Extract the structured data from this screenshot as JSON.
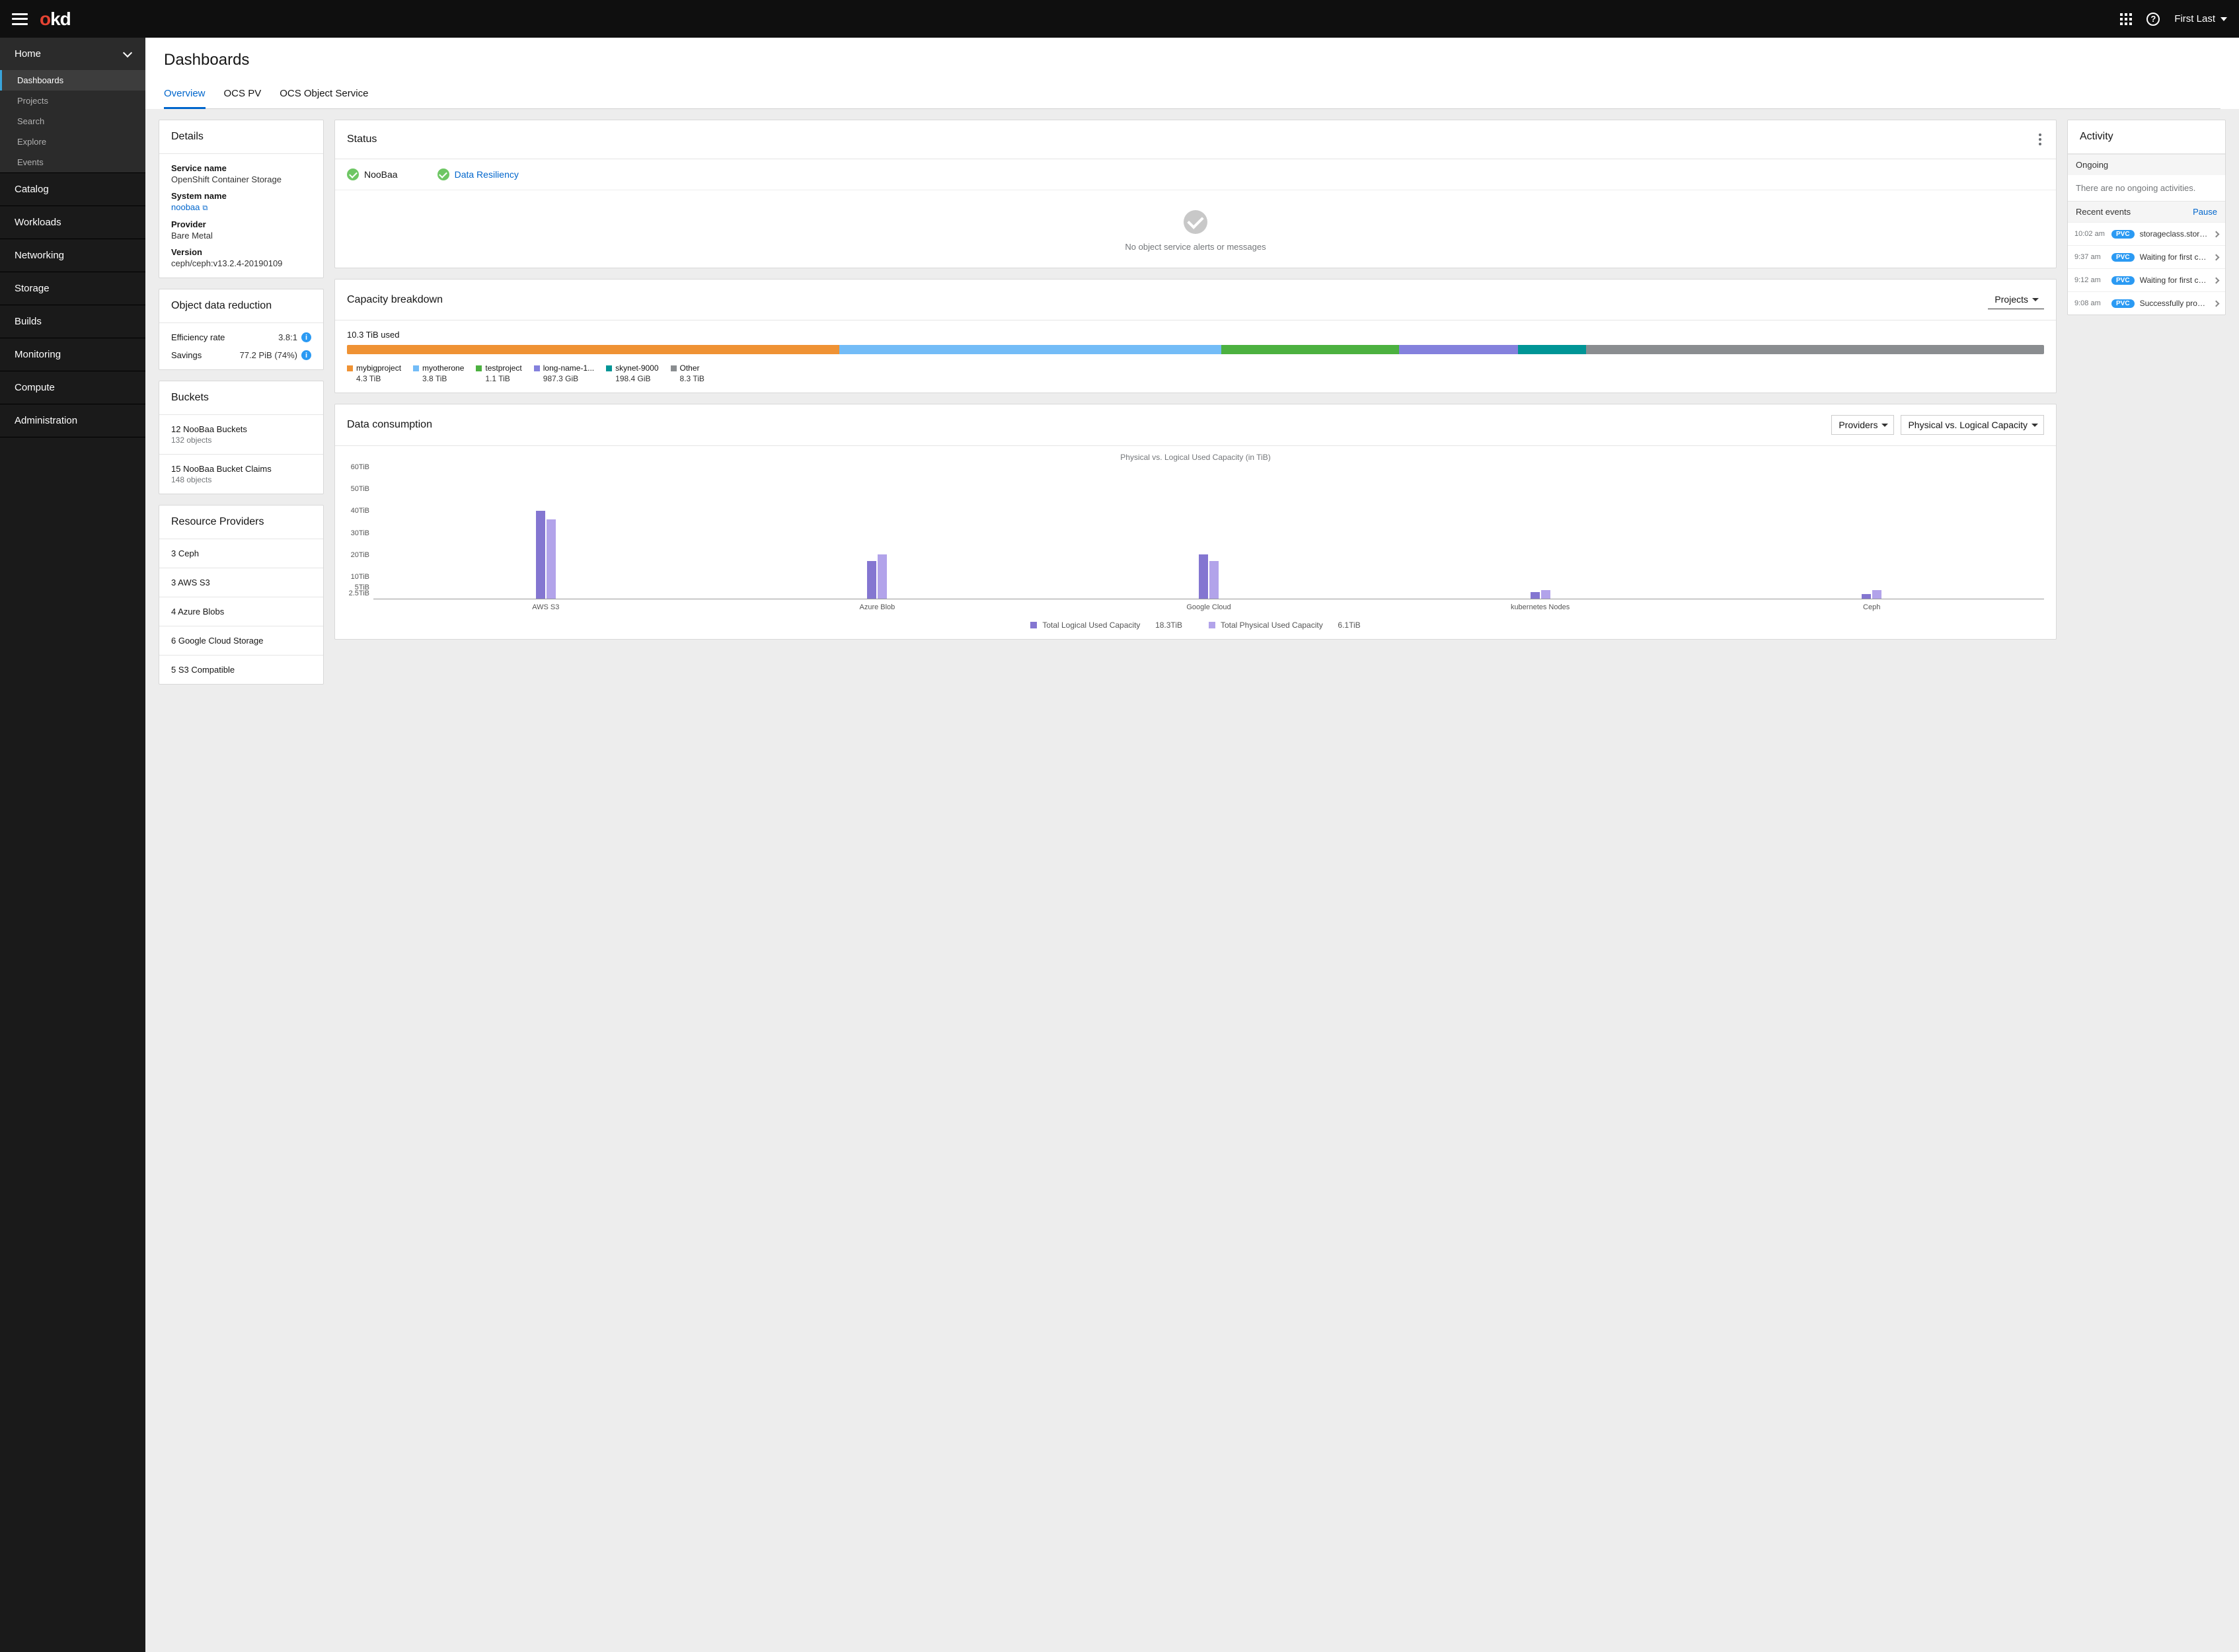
{
  "topbar": {
    "user": "First Last"
  },
  "sidebar": {
    "home": {
      "label": "Home",
      "items": [
        "Dashboards",
        "Projects",
        "Search",
        "Explore",
        "Events"
      ],
      "active": 0
    },
    "items": [
      "Catalog",
      "Workloads",
      "Networking",
      "Storage",
      "Builds",
      "Monitoring",
      "Compute",
      "Administration"
    ]
  },
  "page": {
    "title": "Dashboards"
  },
  "tabs": {
    "active": 0,
    "items": [
      "Overview",
      "OCS PV",
      "OCS Object Service"
    ]
  },
  "details": {
    "heading": "Details",
    "service_name_lbl": "Service name",
    "service_name": "OpenShift Container Storage",
    "system_name_lbl": "System name",
    "system_name": "noobaa",
    "provider_lbl": "Provider",
    "provider": "Bare Metal",
    "version_lbl": "Version",
    "version": "ceph/ceph:v13.2.4-20190109"
  },
  "reduction": {
    "heading": "Object data reduction",
    "eff_lbl": "Efficiency rate",
    "eff_val": "3.8:1",
    "sav_lbl": "Savings",
    "sav_val": "77.2 PiB (74%)"
  },
  "buckets": {
    "heading": "Buckets",
    "rows": [
      {
        "title": "12 NooBaa Buckets",
        "sub": "132 objects"
      },
      {
        "title": "15 NooBaa Bucket Claims",
        "sub": "148 objects"
      }
    ]
  },
  "providers": {
    "heading": "Resource Providers",
    "rows": [
      "3 Ceph",
      "3 AWS S3",
      "4 Azure Blobs",
      "6 Google Cloud Storage",
      "5 S3 Compatible"
    ]
  },
  "status": {
    "heading": "Status",
    "items": [
      {
        "label": "NooBaa",
        "link": false
      },
      {
        "label": "Data Resiliency",
        "link": true
      }
    ],
    "empty": "No object service alerts or messages"
  },
  "capacity": {
    "heading": "Capacity breakdown",
    "selector": "Projects",
    "used": "10.3 TiB used",
    "segments": [
      {
        "name": "mybigproject",
        "value": "4.3 TiB",
        "color": "#ef9234",
        "width": 29
      },
      {
        "name": "myotherone",
        "value": "3.8 TiB",
        "color": "#73bcf7",
        "width": 22.5
      },
      {
        "name": "testproject",
        "value": "1.1 TiB",
        "color": "#4cb140",
        "width": 10.5
      },
      {
        "name": "long-name-1...",
        "value": "987.3 GiB",
        "color": "#8481dd",
        "width": 7
      },
      {
        "name": "skynet-9000",
        "value": "198.4 GiB",
        "color": "#009596",
        "width": 4
      },
      {
        "name": "Other",
        "value": "8.3 TiB",
        "color": "#8a8d90",
        "width": 27
      }
    ]
  },
  "consumption": {
    "heading": "Data consumption",
    "sel1": "Providers",
    "sel2": "Physical vs. Logical Capacity",
    "chart_title": "Physical vs. Logical Used Capacity (in TiB)",
    "legend": {
      "logical_lbl": "Total Logical Used Capacity",
      "logical_val": "18.3TiB",
      "physical_lbl": "Total Physical Used Capacity",
      "physical_val": "6.1TiB"
    }
  },
  "chart_data": {
    "type": "bar",
    "title": "Physical vs. Logical Used Capacity (in TiB)",
    "ylabel": "TiB",
    "ylim": [
      0,
      60
    ],
    "y_ticks": [
      2.5,
      5,
      10,
      20,
      30,
      40,
      50,
      60
    ],
    "categories": [
      "AWS S3",
      "Azure Blob",
      "Google Cloud",
      "kubernetes Nodes",
      "Ceph"
    ],
    "series": [
      {
        "name": "Total Logical Used Capacity",
        "color": "#8476d1",
        "values": [
          40,
          17,
          20,
          3,
          2
        ]
      },
      {
        "name": "Total Physical Used Capacity",
        "color": "#b2a3ea",
        "values": [
          36,
          20,
          17,
          4,
          4
        ]
      }
    ]
  },
  "activity": {
    "heading": "Activity",
    "ongoing_lbl": "Ongoing",
    "ongoing_empty": "There are no ongoing activities.",
    "recent_lbl": "Recent events",
    "pause": "Pause",
    "events": [
      {
        "time": "10:02 am",
        "badge": "PVC",
        "msg": "storageclass.storage.k..."
      },
      {
        "time": "9:37 am",
        "badge": "PVC",
        "msg": "Waiting for first consu..."
      },
      {
        "time": "9:12 am",
        "badge": "PVC",
        "msg": "Waiting for first consu..."
      },
      {
        "time": "9:08 am",
        "badge": "PVC",
        "msg": "Successfully provision..."
      }
    ]
  }
}
